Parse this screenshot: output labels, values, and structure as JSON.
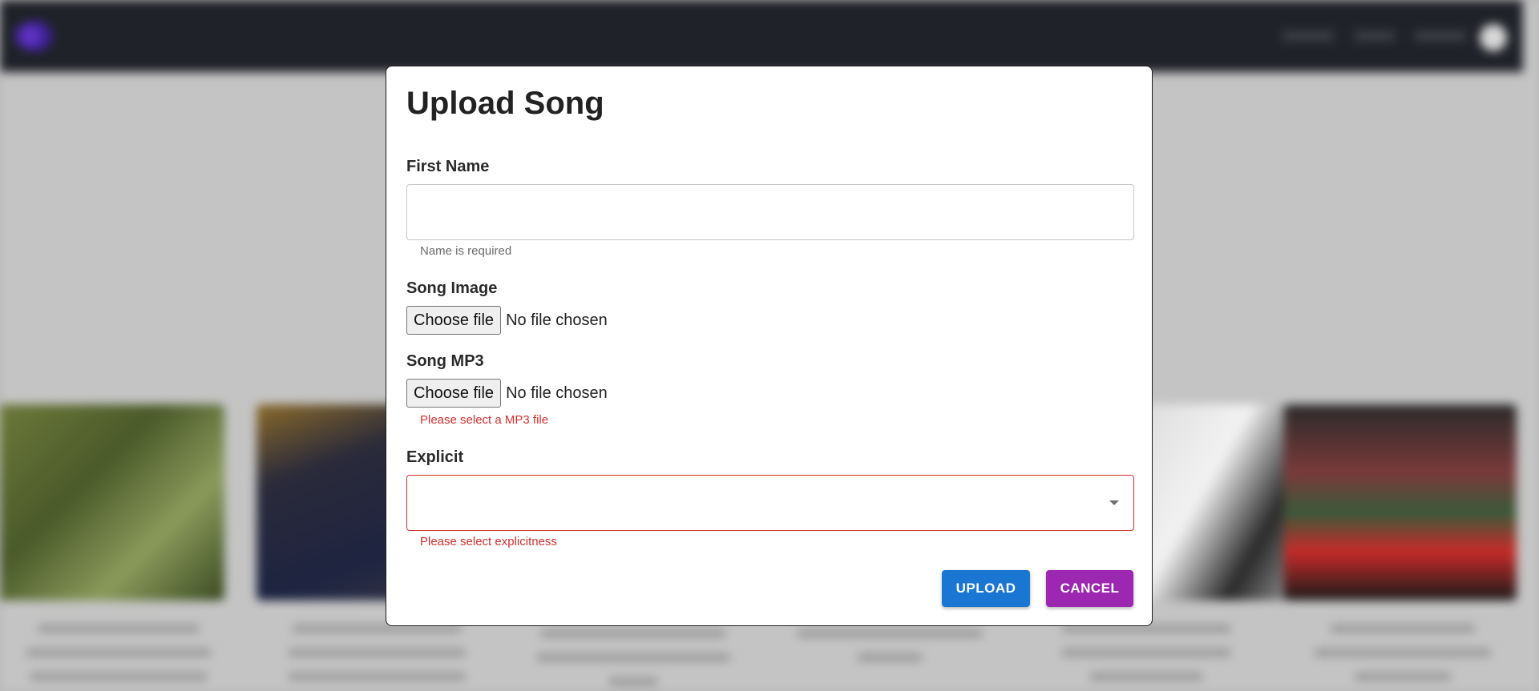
{
  "modal": {
    "title": "Upload Song",
    "first_name": {
      "label": "First Name",
      "value": "",
      "placeholder": "",
      "helper": "Name is required"
    },
    "song_image": {
      "label": "Song Image",
      "button": "Choose file",
      "status": "No file chosen"
    },
    "song_mp3": {
      "label": "Song MP3",
      "button": "Choose file",
      "status": "No file chosen",
      "error": "Please select a MP3 file"
    },
    "explicit": {
      "label": "Explicit",
      "value": "",
      "error": "Please select explicitness"
    },
    "upload_label": "UPLOAD",
    "cancel_label": "CANCEL"
  },
  "colors": {
    "primary": "#1976d2",
    "secondary": "#9c27b0",
    "error": "#d32f2f",
    "navbar": "#1f2228"
  }
}
